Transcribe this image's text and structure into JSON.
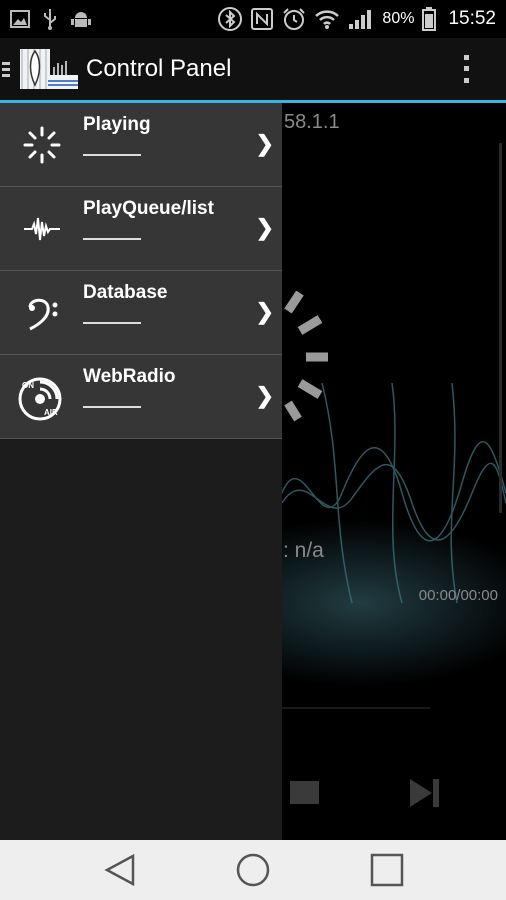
{
  "status_bar": {
    "left_icons": [
      "image-icon",
      "usb-icon",
      "android-debug-icon"
    ],
    "right_icons": [
      "bluetooth-icon",
      "nfc-icon",
      "alarm-icon",
      "wifi-icon",
      "signal-icon"
    ],
    "battery_percent": "80%",
    "time": "15:52"
  },
  "action_bar": {
    "title": "Control Panel",
    "accent_color": "#33b5e5"
  },
  "background": {
    "ip_fragment": "58.1.1",
    "now_playing_fragment": ": n/a",
    "elapsed_total": "00:00/00:00"
  },
  "drawer": {
    "items": [
      {
        "label": "Playing",
        "icon": "playing-spinner-icon"
      },
      {
        "label": "PlayQueue/list",
        "icon": "waveform-icon"
      },
      {
        "label": "Database",
        "icon": "bass-clef-icon"
      },
      {
        "label": "WebRadio",
        "icon": "on-air-icon",
        "icon_text_top": "ON",
        "icon_text_bottom": "AIR"
      }
    ],
    "chevron": "❯"
  },
  "nav_bar": {
    "buttons": [
      "back-icon",
      "home-icon",
      "recents-icon"
    ]
  }
}
